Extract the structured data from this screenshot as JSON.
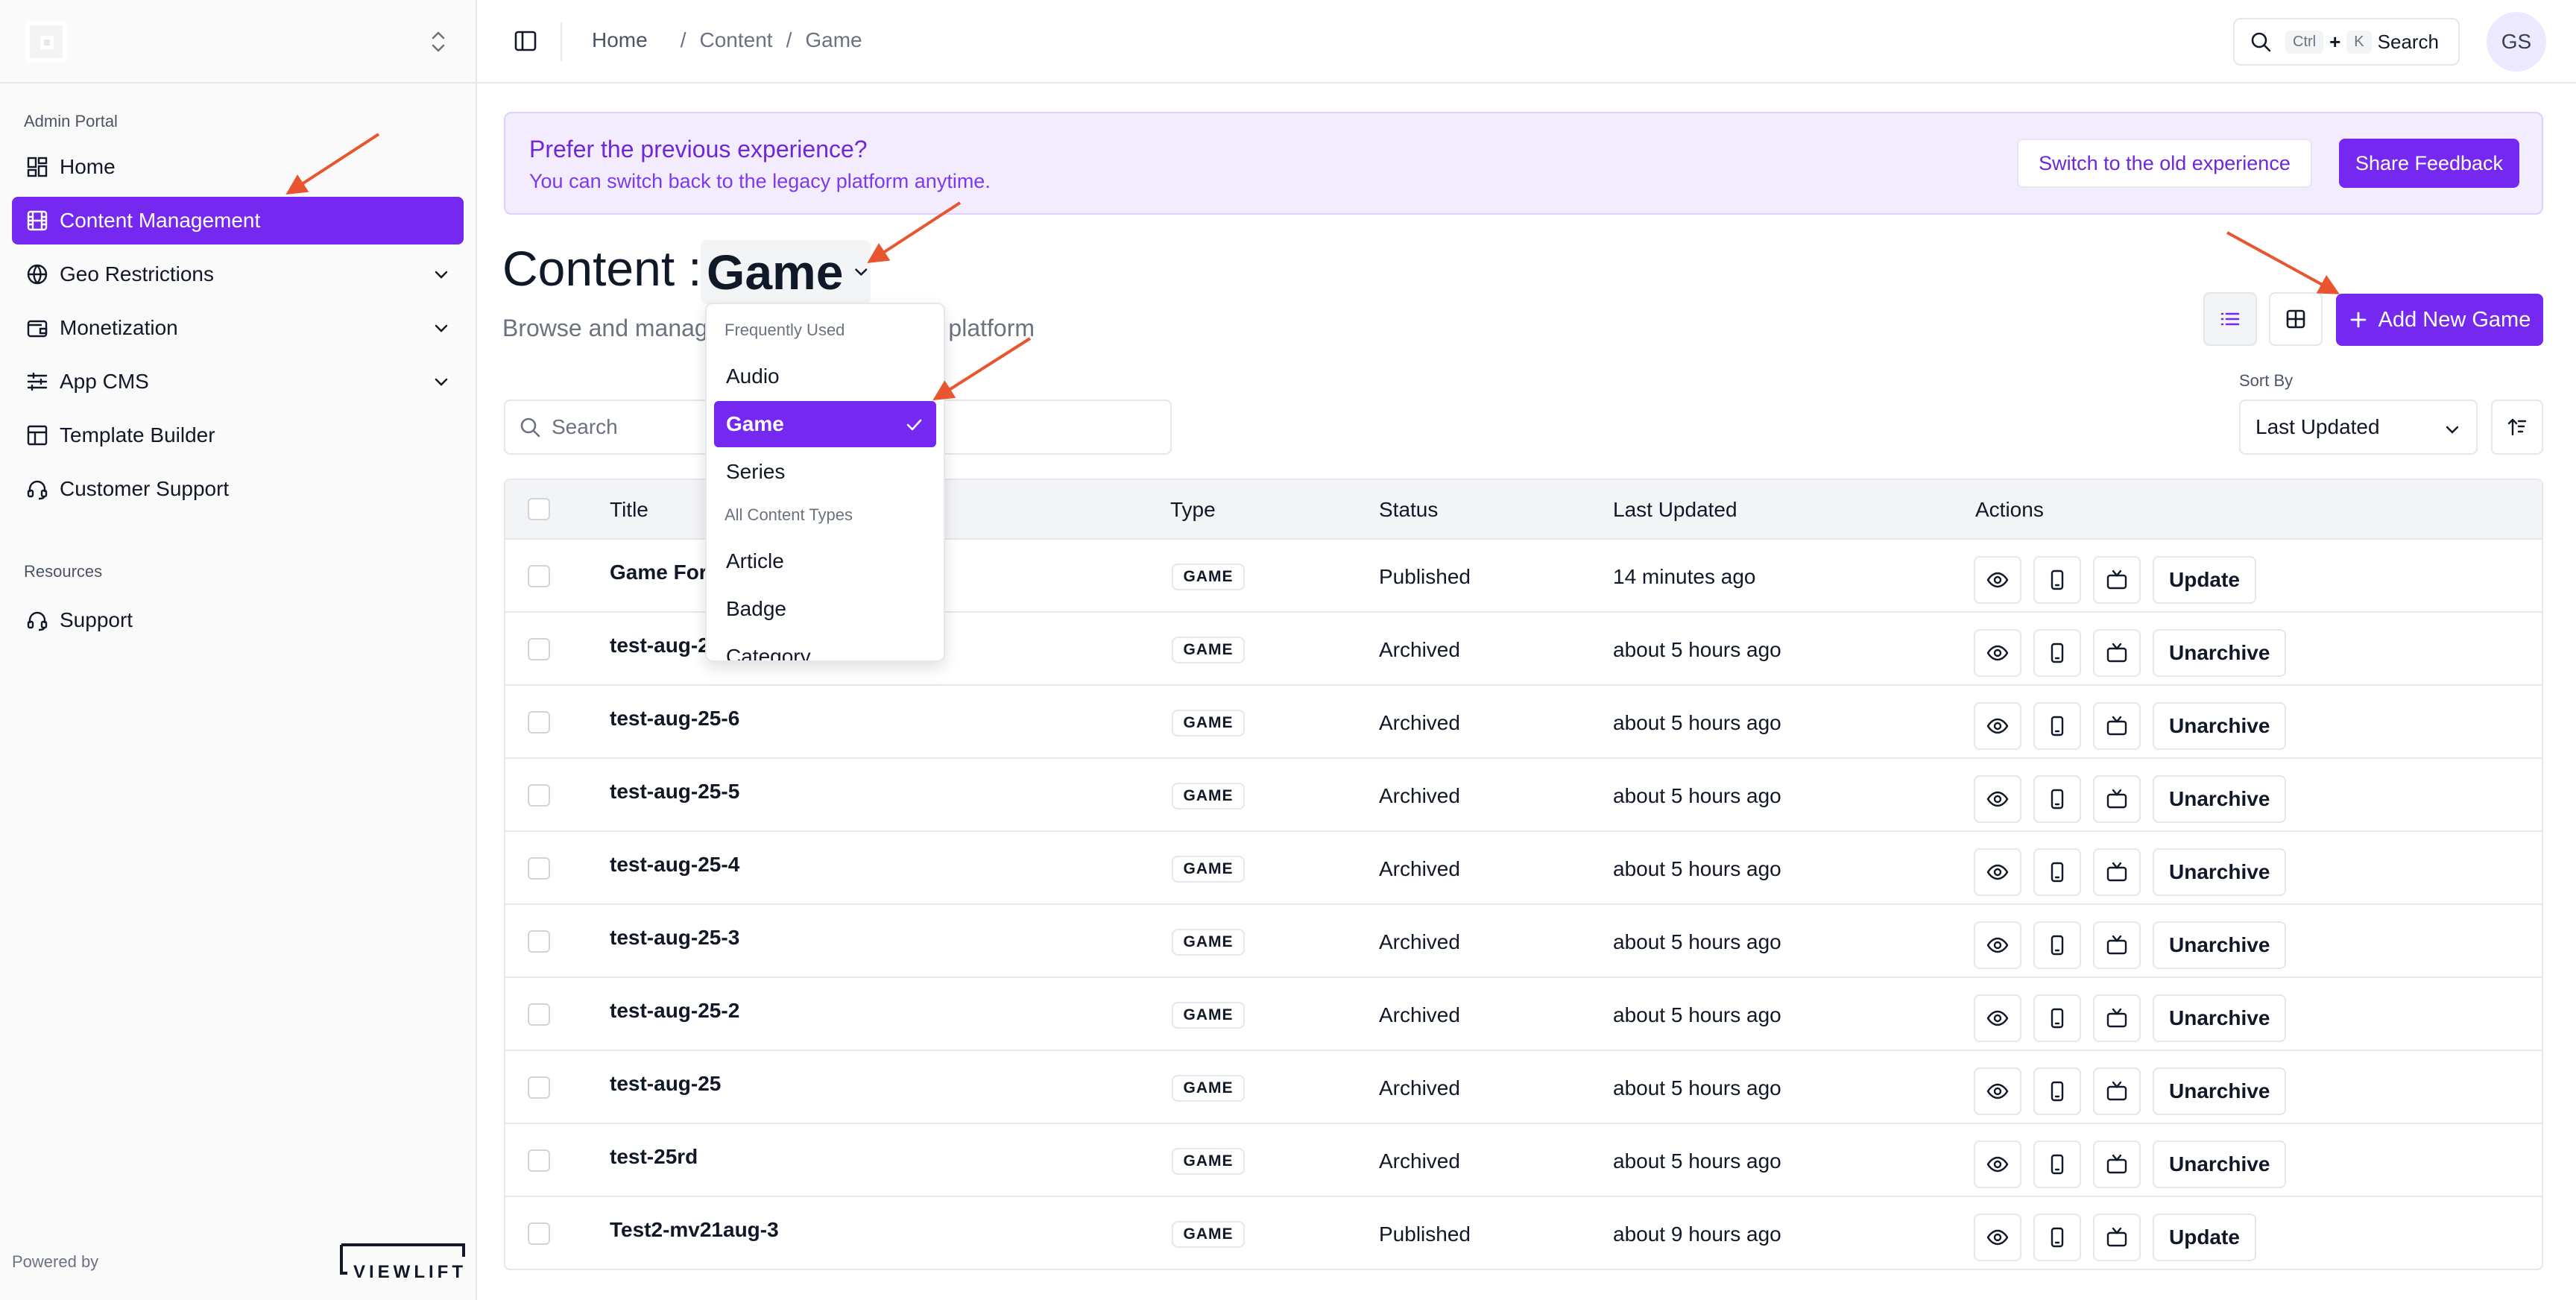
{
  "sidebar": {
    "section_admin": "Admin Portal",
    "section_resources": "Resources",
    "items": [
      {
        "label": "Home",
        "icon": "dashboard-icon"
      },
      {
        "label": "Content Management",
        "icon": "film-icon",
        "active": true
      },
      {
        "label": "Geo Restrictions",
        "icon": "globe-icon"
      },
      {
        "label": "Monetization",
        "icon": "wallet-icon"
      },
      {
        "label": "App CMS",
        "icon": "sliders-icon"
      },
      {
        "label": "Template Builder",
        "icon": "layout-icon"
      },
      {
        "label": "Customer Support",
        "icon": "headset-icon"
      },
      {
        "label": "Support",
        "icon": "headset-icon"
      }
    ],
    "powered_by": "Powered by",
    "brand": "VIEWLIFT"
  },
  "topbar": {
    "breadcrumb": [
      "Home",
      "Content",
      "Game"
    ],
    "search_label": "Search",
    "search_kbd": [
      "Ctrl",
      "+",
      "K"
    ],
    "avatar_initials": "GS"
  },
  "banner": {
    "title": "Prefer the previous experience?",
    "subtitle": "You can switch back to the legacy platform anytime.",
    "switch_label": "Switch to the old experience",
    "feedback_label": "Share Feedback"
  },
  "header": {
    "title": "Content",
    "colon": ":",
    "selected_type": "Game",
    "subtitle_left": "Browse and manag",
    "subtitle_right": "e platform",
    "add_button": "Add New Game"
  },
  "filters": {
    "search_placeholder": "Search",
    "sort_label": "Sort By",
    "sort_value": "Last Updated"
  },
  "dropdown": {
    "group_frequent": "Frequently Used",
    "frequent": [
      "Audio",
      "Game",
      "Series"
    ],
    "group_all": "All Content Types",
    "all": [
      "Article",
      "Badge",
      "Category"
    ],
    "selected": "Game"
  },
  "table": {
    "columns": [
      "Title",
      "Type",
      "Status",
      "Last Updated",
      "Actions"
    ],
    "rows": [
      {
        "title": "Game For",
        "type": "GAME",
        "status": "Published",
        "updated": "14 minutes ago",
        "action": "Update"
      },
      {
        "title": "test-aug-2",
        "type": "GAME",
        "status": "Archived",
        "updated": "about 5 hours ago",
        "action": "Unarchive"
      },
      {
        "title": "test-aug-25-6",
        "type": "GAME",
        "status": "Archived",
        "updated": "about 5 hours ago",
        "action": "Unarchive"
      },
      {
        "title": "test-aug-25-5",
        "type": "GAME",
        "status": "Archived",
        "updated": "about 5 hours ago",
        "action": "Unarchive"
      },
      {
        "title": "test-aug-25-4",
        "type": "GAME",
        "status": "Archived",
        "updated": "about 5 hours ago",
        "action": "Unarchive"
      },
      {
        "title": "test-aug-25-3",
        "type": "GAME",
        "status": "Archived",
        "updated": "about 5 hours ago",
        "action": "Unarchive"
      },
      {
        "title": "test-aug-25-2",
        "type": "GAME",
        "status": "Archived",
        "updated": "about 5 hours ago",
        "action": "Unarchive"
      },
      {
        "title": "test-aug-25",
        "type": "GAME",
        "status": "Archived",
        "updated": "about 5 hours ago",
        "action": "Unarchive"
      },
      {
        "title": "test-25rd",
        "type": "GAME",
        "status": "Archived",
        "updated": "about 5 hours ago",
        "action": "Unarchive"
      },
      {
        "title": "Test2-mv21aug-3",
        "type": "GAME",
        "status": "Published",
        "updated": "about 9 hours ago",
        "action": "Update"
      }
    ]
  },
  "colors": {
    "accent": "#7428f0",
    "banner_bg": "#f3ebfe",
    "annotation_arrow": "#e8552f"
  }
}
